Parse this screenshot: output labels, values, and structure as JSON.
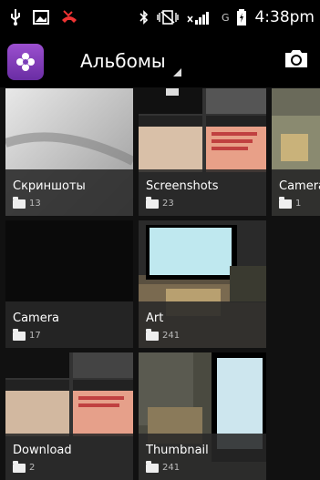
{
  "status": {
    "time": "4:38pm",
    "network": "G"
  },
  "app": {
    "title": "Альбомы"
  },
  "albums": [
    {
      "name": "Скриншоты",
      "count": "13"
    },
    {
      "name": "Screenshots",
      "count": "23"
    },
    {
      "name": "Camera",
      "count": "1"
    },
    {
      "name": "Camera",
      "count": "17"
    },
    {
      "name": "Art",
      "count": "241"
    },
    {
      "name": "Download",
      "count": "2"
    },
    {
      "name": "Thumbnail",
      "count": "241"
    }
  ],
  "colors": {
    "accent": "#7b3fb8",
    "background": "#111111"
  },
  "icons": [
    "usb-icon",
    "image-icon",
    "missed-call-icon",
    "bluetooth-icon",
    "vibrate-icon",
    "signal-icon",
    "battery-icon",
    "app-logo-icon",
    "camera-icon",
    "folder-icon"
  ]
}
